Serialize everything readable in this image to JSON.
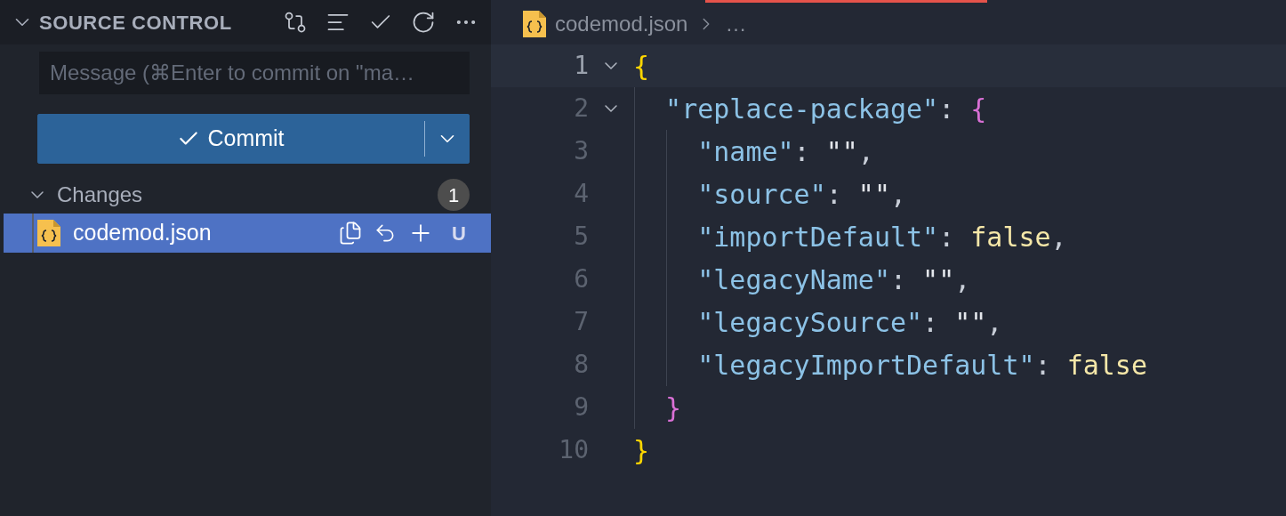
{
  "sidebar": {
    "title": "SOURCE CONTROL",
    "expanded": true,
    "message": {
      "placeholder": "Message (⌘Enter to commit on \"ma…"
    },
    "commit": {
      "label": "Commit"
    },
    "changes": {
      "label": "Changes",
      "expanded": true,
      "count": "1",
      "files": [
        {
          "name": "codemod.json",
          "status": "U",
          "selected": true
        }
      ]
    }
  },
  "editor": {
    "breadcrumb": [
      "codemod.json",
      "…"
    ],
    "lines": [
      {
        "number": "1",
        "foldable": true,
        "current": true,
        "tokens": [
          {
            "kind": "brace-1",
            "text": "{"
          }
        ],
        "children": [
          {
            "number": "2",
            "foldable": true,
            "current": false,
            "tokens": [
              {
                "kind": "key",
                "text": "\"replace-package\""
              },
              {
                "kind": "punct",
                "text": ": "
              },
              {
                "kind": "brace-2",
                "text": "{"
              }
            ],
            "children": [
              {
                "number": "3",
                "foldable": false,
                "current": false,
                "tokens": [
                  {
                    "kind": "key",
                    "text": "\"name\""
                  },
                  {
                    "kind": "punct",
                    "text": ": "
                  },
                  {
                    "kind": "string",
                    "text": "\"\""
                  },
                  {
                    "kind": "punct",
                    "text": ","
                  }
                ]
              },
              {
                "number": "4",
                "foldable": false,
                "current": false,
                "tokens": [
                  {
                    "kind": "key",
                    "text": "\"source\""
                  },
                  {
                    "kind": "punct",
                    "text": ": "
                  },
                  {
                    "kind": "string",
                    "text": "\"\""
                  },
                  {
                    "kind": "punct",
                    "text": ","
                  }
                ]
              },
              {
                "number": "5",
                "foldable": false,
                "current": false,
                "tokens": [
                  {
                    "kind": "key",
                    "text": "\"importDefault\""
                  },
                  {
                    "kind": "punct",
                    "text": ": "
                  },
                  {
                    "kind": "boolean",
                    "text": "false"
                  },
                  {
                    "kind": "punct",
                    "text": ","
                  }
                ]
              },
              {
                "number": "6",
                "foldable": false,
                "current": false,
                "tokens": [
                  {
                    "kind": "key",
                    "text": "\"legacyName\""
                  },
                  {
                    "kind": "punct",
                    "text": ": "
                  },
                  {
                    "kind": "string",
                    "text": "\"\""
                  },
                  {
                    "kind": "punct",
                    "text": ","
                  }
                ]
              },
              {
                "number": "7",
                "foldable": false,
                "current": false,
                "tokens": [
                  {
                    "kind": "key",
                    "text": "\"legacySource\""
                  },
                  {
                    "kind": "punct",
                    "text": ": "
                  },
                  {
                    "kind": "string",
                    "text": "\"\""
                  },
                  {
                    "kind": "punct",
                    "text": ","
                  }
                ]
              },
              {
                "number": "8",
                "foldable": false,
                "current": false,
                "tokens": [
                  {
                    "kind": "key",
                    "text": "\"legacyImportDefault\""
                  },
                  {
                    "kind": "punct",
                    "text": ": "
                  },
                  {
                    "kind": "boolean",
                    "text": "false"
                  }
                ]
              }
            ]
          },
          {
            "number": "9",
            "foldable": false,
            "current": false,
            "tokens": [
              {
                "kind": "brace-2",
                "text": "}"
              }
            ]
          }
        ]
      },
      {
        "number": "10",
        "foldable": false,
        "current": false,
        "tokens": [
          {
            "kind": "brace-1",
            "text": "}"
          }
        ]
      }
    ]
  }
}
